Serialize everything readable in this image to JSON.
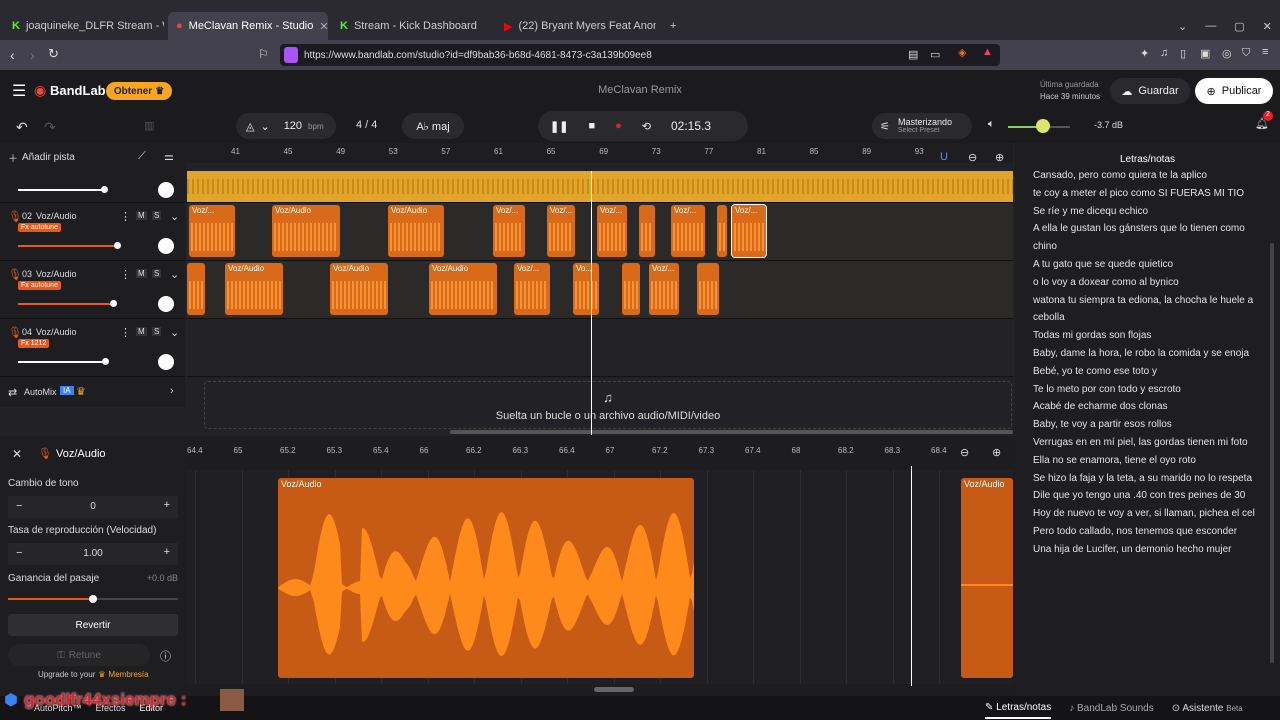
{
  "browser": {
    "tabs": [
      {
        "label": "joaquineke_DLFR Stream - Watch Li..."
      },
      {
        "label": "MeClavan Remix - Studio",
        "active": true
      },
      {
        "label": "Stream - Kick Dashboard"
      },
      {
        "label": "(22) Bryant Myers Feat Anonimus, An..."
      }
    ],
    "url": "https://www.bandlab.com/studio?id=df9bab36-b68d-4681-8473-c3a139b09ee8"
  },
  "app": {
    "brand": "BandLab",
    "get_button": "Obtener",
    "project_title": "MeClavan Remix",
    "last_saved_label": "Última guardada",
    "last_saved_time": "Hace 39 minutos",
    "save_button": "Guardar",
    "publish_button": "Publicar",
    "notification_count": "2"
  },
  "transport": {
    "tempo": "120",
    "tempo_unit": "bpm",
    "time_signature": "4 / 4",
    "key": "A♭ maj",
    "time": "02:15.3",
    "mastering": "Masterizando",
    "select_preset": "Select Preset",
    "volume": "-3.7 dB"
  },
  "tracks_panel": {
    "add_track": "Añadir pista",
    "ruler_marks": [
      "41",
      "45",
      "49",
      "53",
      "57",
      "61",
      "65",
      "69",
      "73",
      "77",
      "81",
      "85",
      "89",
      "93"
    ],
    "tracks": [
      {
        "number": "02",
        "name": "Voz/Audio",
        "fx": "Fx autotune"
      },
      {
        "number": "03",
        "name": "Voz/Audio",
        "fx": "Fx autotune"
      },
      {
        "number": "04",
        "name": "Voz/Audio",
        "fx": "Fx 1212"
      }
    ],
    "automix": "AutoMix",
    "automix_badge": "IA",
    "drop_hint": "Suelta un bucle o un archivo audio/MIDI/video",
    "clip_label": "Voz/Audio",
    "clip_label_short": "Voz/...",
    "clip_label_tiny": "Vo..."
  },
  "editor": {
    "title": "Voz/Audio",
    "pitch_label": "Cambio de tono",
    "pitch_value": "0",
    "rate_label": "Tasa de reproducción (Velocidad)",
    "rate_value": "1.00",
    "gain_label": "Ganancia del pasaje",
    "gain_value": "+0.0 dB",
    "revert": "Revertir",
    "retune": "Retune",
    "upgrade_prefix": "Upgrade to your",
    "upgrade_link": "Membresía",
    "ruler_marks": [
      "64.4",
      "65",
      "65.2",
      "65.3",
      "65.4",
      "66",
      "66.2",
      "66.3",
      "66.4",
      "67",
      "67.2",
      "67.3",
      "67.4",
      "68",
      "68.2",
      "68.3",
      "68.4"
    ],
    "clip_label": "Voz/Audio"
  },
  "lyrics": {
    "title": "Letras/notas",
    "lines": [
      "Cansado, pero como quiera te la aplico",
      "te coy a meter el pico como SI FUERAS MI TIO",
      "Se ríe y me dicequ echico",
      "A ella le gustan los gánsters que lo tienen como chino",
      "A tu gato que se quede quietico",
      "o lo voy a doxear como al bynico",
      "watona tu siempra ta ediona, la chocha le huele a cebolla",
      "Todas mi gordas son flojas",
      "Baby, dame la hora, le robo la comida y se enoja",
      "Bebé, yo te como ese toto y",
      "Te lo meto por con todo y escroto",
      "Acabé de echarme dos clonas",
      "Baby, te voy a partir esos rollos",
      "Verrugas en en mí piel, las gordas tienen mi foto",
      "Ella no se enamora, tiene el oyo roto",
      "Se hizo la faja y la teta, a su marido no lo respeta",
      "Dile que yo tengo una .40 con tres peines de 30",
      "Hoy de nuevo te voy a ver, si llaman, pichea el cel",
      "Pero todo callado, nos tenemos que esconder",
      "Una hija de Lucifer, un demonio hecho mujer"
    ]
  },
  "bottom_tabs": {
    "lyrics": "Letras/notas",
    "sounds": "BandLab Sounds",
    "assistant": "Asistente",
    "beta": "Beta",
    "autopitch": "AutoPitch™",
    "effects": "Efectos",
    "editor": "Editor"
  },
  "overlay": {
    "username": "goodlfr44xsiempre :"
  },
  "colors": {
    "accent": "#e85a1c",
    "clip": "#d86a1a",
    "master_track": "#e0a52a",
    "get_badge": "#f5a623"
  }
}
